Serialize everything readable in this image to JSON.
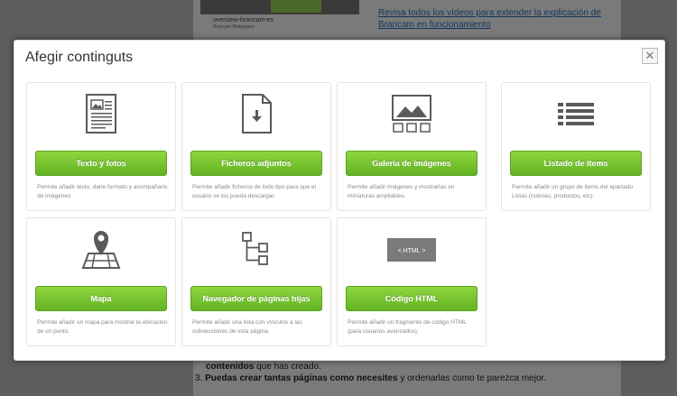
{
  "background": {
    "video_caption": "overview-brancam-es",
    "video_sub": "Brancam Webpages",
    "link_text": "Revisa todos los vídeos para extender la explicación de Brancam en funcionamiento",
    "bottom_line1_bold": "contenidos",
    "bottom_line1_rest": " que has creado.",
    "bottom_line2_num": "3.",
    "bottom_line2_bold": "Puedas crear tantas páginas como necesites",
    "bottom_line2_rest": " y ordenarlas como te parezca mejor."
  },
  "modal": {
    "title": "Afegir continguts",
    "close_label": "✕",
    "cards": [
      {
        "icon": "document-icon",
        "button": "Texto y fotos",
        "description": "Permite añadir texto, darle formato y acompañarlo de imágenes"
      },
      {
        "icon": "file-download-icon",
        "button": "Ficheros adjuntos",
        "description": "Permite añadir ficheros de todo tipo para que el usuario se los pueda descargar."
      },
      {
        "icon": "image-gallery-icon",
        "button": "Galeria de imágenes",
        "description": "Permite añadir imágenes y mostrarlas en miniaturas ampliables."
      },
      {
        "icon": "list-icon",
        "button": "Listado de items",
        "description": "Permite añadir un grupo de items del apartado Listas (noticias, productos, etc)."
      },
      {
        "icon": "map-pin-icon",
        "button": "Mapa",
        "description": "Permite añadir un mapa para mostrar la ubicación de un punto."
      },
      {
        "icon": "sitemap-icon",
        "button": "Navegador de páginas hijas",
        "description": "Permite añadir una lista con vínculos a las subsecciones de esta página."
      },
      {
        "icon": "html-code-icon",
        "button": "Código HTML",
        "description": "Permite añadir un fragmento de código HTML (para usuarios avanzados)."
      }
    ]
  },
  "colors": {
    "button_green": "#6cbd2a",
    "overlay": "#5e5e5e",
    "icon_gray": "#5a5a5a"
  }
}
